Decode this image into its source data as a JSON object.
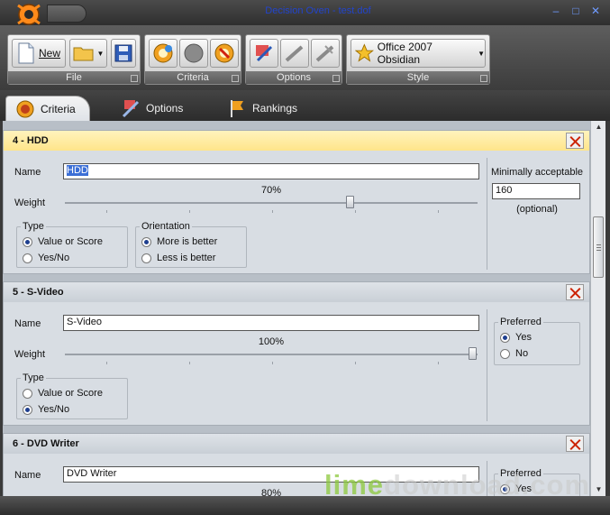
{
  "window": {
    "title": "Decision Oven - test.dof",
    "buttons": [
      "–",
      "□",
      "✕"
    ]
  },
  "ribbon": {
    "groups": [
      {
        "label": "File",
        "new_label": "New"
      },
      {
        "label": "Criteria"
      },
      {
        "label": "Options"
      },
      {
        "label": "Style",
        "style_value": "Office 2007 Obsidian"
      }
    ]
  },
  "tabs": [
    {
      "label": "Criteria",
      "icon": "criteria-icon",
      "active": true
    },
    {
      "label": "Options",
      "icon": "options-icon",
      "active": false
    },
    {
      "label": "Rankings",
      "icon": "rankings-flag-icon",
      "active": false
    }
  ],
  "criteria": [
    {
      "header": "4 - HDD",
      "name_label": "Name",
      "name_value": "HDD",
      "weight_label": "Weight",
      "weight_text": "70%",
      "weight": 0.7,
      "type_legend": "Type",
      "type_options": [
        "Value or Score",
        "Yes/No"
      ],
      "type_selected": 0,
      "orientation_legend": "Orientation",
      "orientation_options": [
        "More is better",
        "Less is better"
      ],
      "orientation_selected": 0,
      "min_label": "Minimally acceptable",
      "min_value": "160",
      "optional_label": "(optional)"
    },
    {
      "header": "5 - S-Video",
      "name_label": "Name",
      "name_value": "S-Video",
      "weight_label": "Weight",
      "weight_text": "100%",
      "weight": 1.0,
      "type_legend": "Type",
      "type_options": [
        "Value or Score",
        "Yes/No"
      ],
      "type_selected": 1,
      "preferred_legend": "Preferred",
      "preferred_options": [
        "Yes",
        "No"
      ],
      "preferred_selected": 0
    },
    {
      "header": "6 - DVD Writer",
      "name_label": "Name",
      "name_value": "DVD Writer",
      "weight_text": "80%",
      "preferred_legend": "Preferred",
      "preferred_options": [
        "Yes"
      ],
      "preferred_selected": 0
    }
  ],
  "watermark": {
    "part1": "lime",
    "part2": "download.com"
  },
  "colors": {
    "highlight_header": "#ffe58a",
    "title_text": "#2244cc",
    "selection": "#3c6fd6",
    "close_x": "#cc2200"
  }
}
